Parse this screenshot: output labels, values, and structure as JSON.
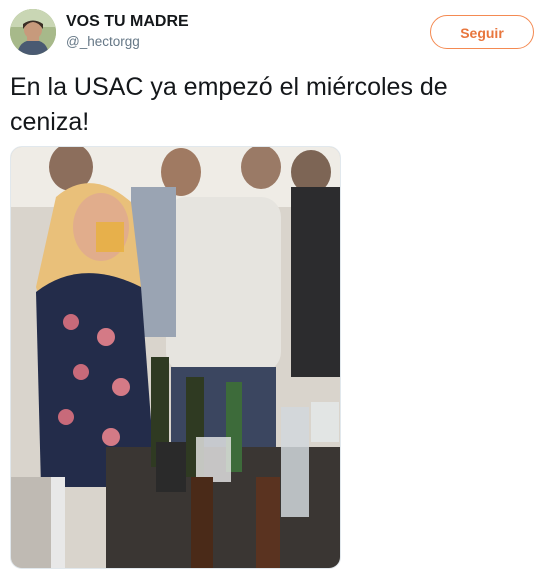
{
  "theme": {
    "accent": "#e8763d",
    "text": "#14171a",
    "muted": "#657786"
  },
  "author": {
    "display_name": "VOS TU MADRE",
    "handle": "@_hectorgg",
    "avatar_icon": "profile-avatar"
  },
  "actions": {
    "follow_label": "Seguir"
  },
  "tweet": {
    "text": "En la USAC ya empezó el miércoles de ceniza!"
  },
  "media": {
    "alt": "photo",
    "description_icon": "photo-of-party"
  }
}
